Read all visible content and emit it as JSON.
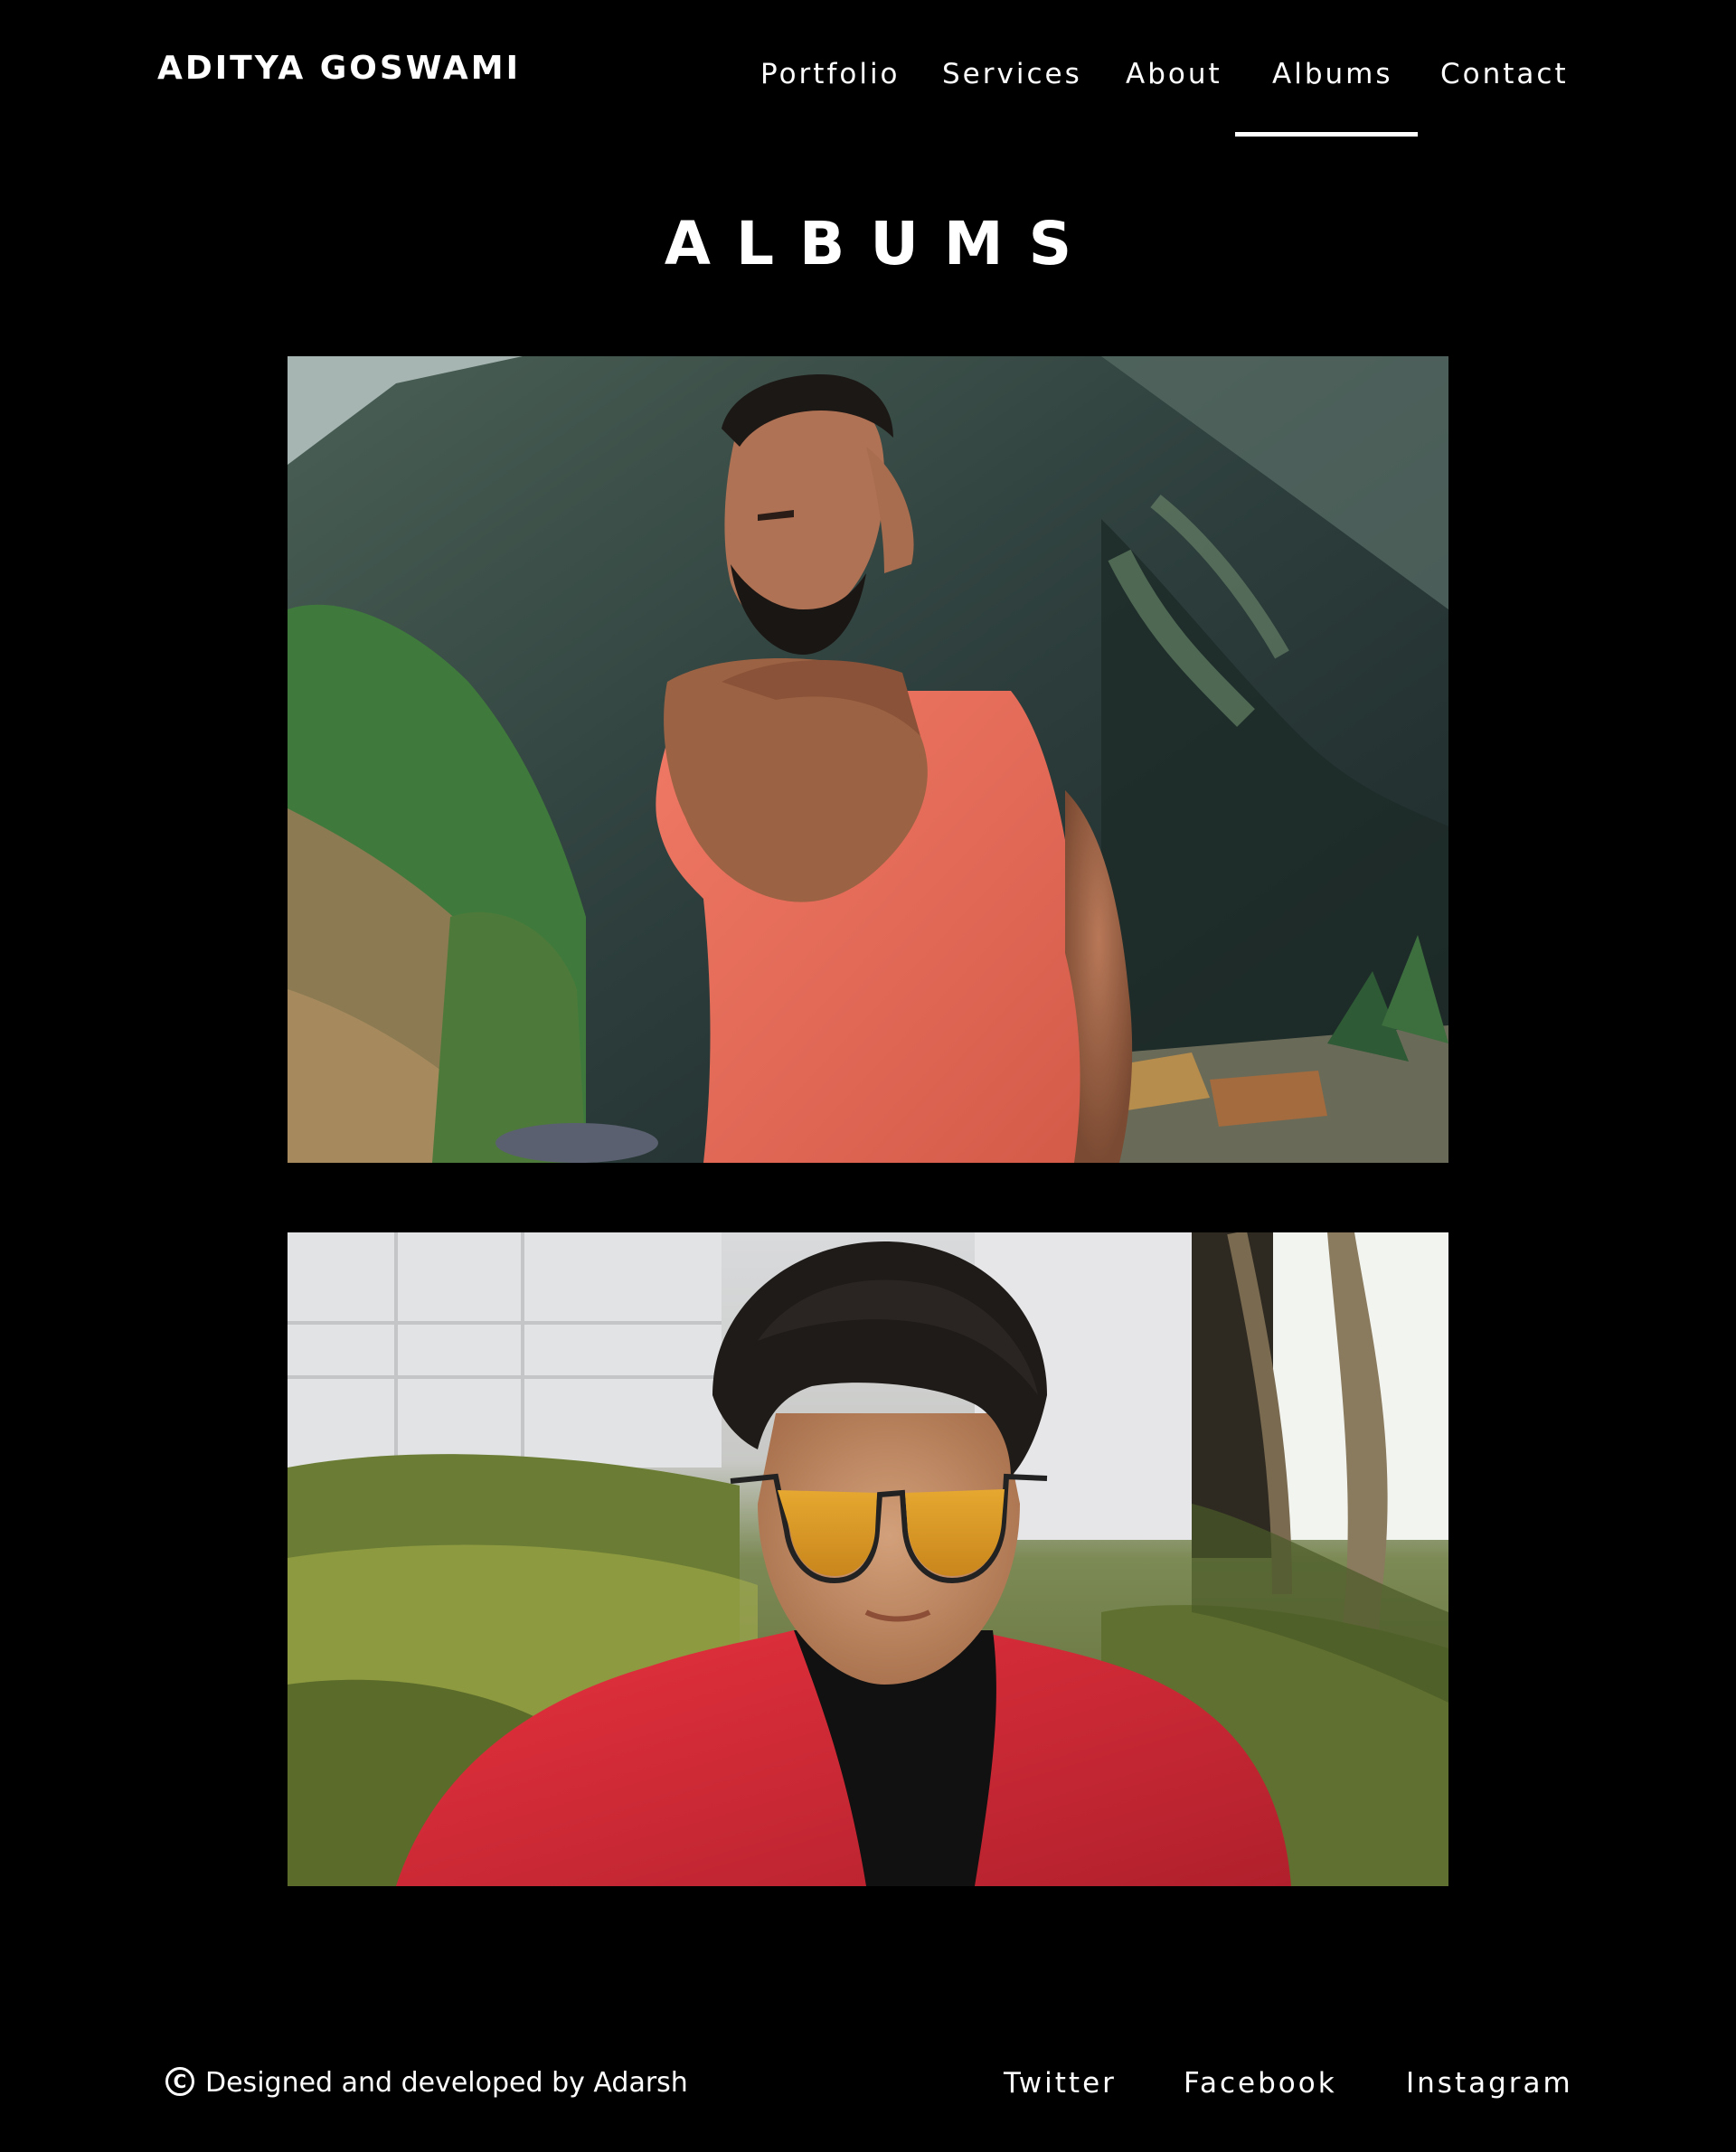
{
  "header": {
    "brand": "ADITYA GOSWAMI",
    "nav": [
      "Portfolio",
      "Services",
      "About",
      "Albums",
      "Contact"
    ],
    "active_nav": "Albums"
  },
  "main": {
    "title": "ALBUMS",
    "albums": [
      {
        "subject": "man-in-coral-tank-top-mountains"
      },
      {
        "subject": "man-in-red-jacket-yellow-sunglasses"
      }
    ]
  },
  "footer": {
    "credit": "Designed and developed by Adarsh",
    "social": [
      "Twitter",
      "Facebook",
      "Instagram"
    ]
  }
}
